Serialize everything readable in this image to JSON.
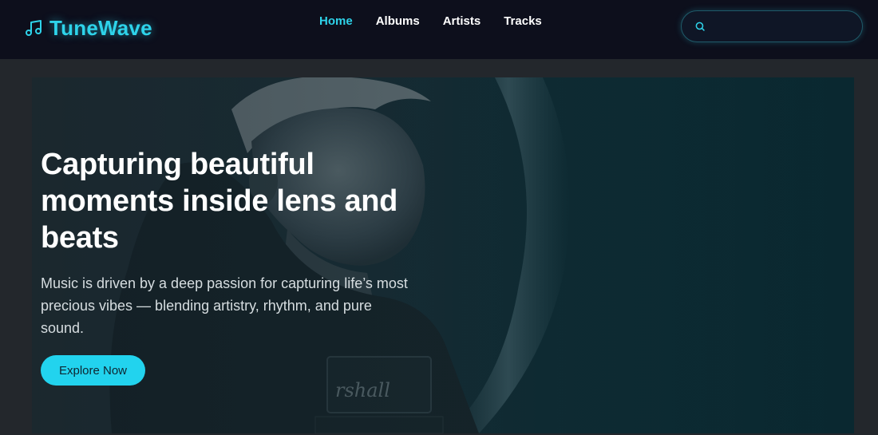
{
  "brand": {
    "name": "TuneWave",
    "icon": "music-note-icon"
  },
  "nav": {
    "items": [
      {
        "label": "Home",
        "active": true
      },
      {
        "label": "Albums",
        "active": false
      },
      {
        "label": "Artists",
        "active": false
      },
      {
        "label": "Tracks",
        "active": false
      }
    ]
  },
  "search": {
    "icon": "search-icon",
    "value": "",
    "placeholder": ""
  },
  "hero": {
    "title": "Capturing beautiful moments inside lens and beats",
    "description": "Music is driven by a deep passion for capturing life’s most precious vibes — blending artistry, rhythm, and pure sound.",
    "cta_label": "Explore Now",
    "amp_logo_text": "rshall"
  },
  "colors": {
    "accent": "#22d3ee",
    "header_bg": "#0d0f1c",
    "page_bg": "#23272c"
  }
}
